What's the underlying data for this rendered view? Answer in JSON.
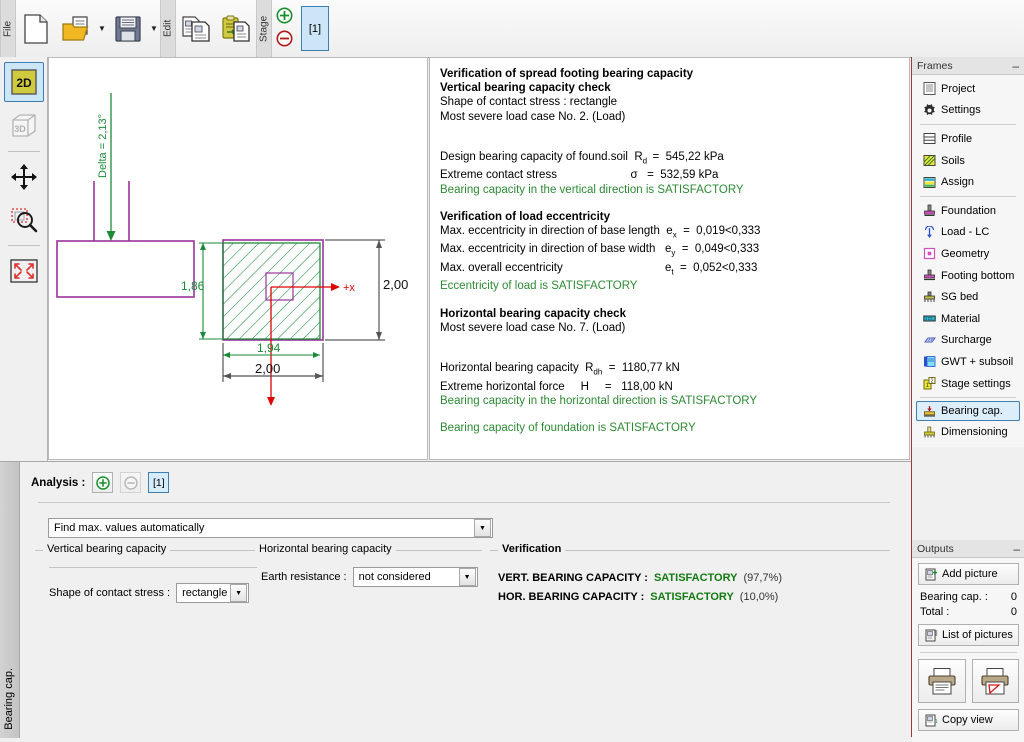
{
  "toolbar": {
    "groups": [
      {
        "caption": "File",
        "buttons": [
          {
            "name": "new-file-button",
            "icon": "new-document-icon"
          },
          {
            "name": "open-file-button",
            "icon": "open-folder-icon",
            "dropdown": true
          },
          {
            "name": "save-file-button",
            "icon": "floppy-save-icon",
            "dropdown": true
          }
        ]
      },
      {
        "caption": "Edit",
        "buttons": [
          {
            "name": "copy-button",
            "icon": "copy-pages-icon"
          },
          {
            "name": "paste-button",
            "icon": "clipboard-paste-icon"
          }
        ]
      },
      {
        "caption": "Stage",
        "buttons": [
          {
            "name": "add-stage-button",
            "icon": "plus-circle-icon"
          },
          {
            "name": "remove-stage-button",
            "icon": "minus-circle-icon"
          }
        ],
        "stage_tab": "[1]"
      }
    ]
  },
  "left_tools": [
    {
      "name": "view-2d-button",
      "label": "2D",
      "selected": true
    },
    {
      "name": "view-3d-button",
      "label": "3D",
      "selected": false
    },
    {
      "name": "pan-tool-button",
      "icon": "move-arrows-icon",
      "selected": false
    },
    {
      "name": "zoom-window-button",
      "icon": "zoom-window-icon",
      "selected": false
    },
    {
      "name": "zoom-all-button",
      "icon": "zoom-extents-icon",
      "selected": false
    },
    {
      "name": "drawing-settings-button",
      "icon": "gear-icon",
      "selected": false
    }
  ],
  "drawing": {
    "delta_label": "Delta = 2,13°",
    "dim_width_inner": "1,86",
    "dim_width_outer": "2,00",
    "dim_length_inner": "1,94",
    "dim_length_outer": "2,00",
    "axis_label": "+x"
  },
  "report": {
    "lines": [
      {
        "text": "Verification of spread footing bearing capacity",
        "style": "bold"
      },
      {
        "text": "Vertical bearing capacity check",
        "style": "bold"
      },
      {
        "text": "Shape of contact stress : rectangle",
        "style": "plain"
      },
      {
        "text": "Most severe load case No. 2. (Load)",
        "style": "plain"
      },
      {
        "text": "",
        "style": "gap"
      },
      {
        "text": "",
        "style": "gap"
      },
      {
        "text": "Design bearing capacity of found.soil  R_d  =  545,22 kPa",
        "style": "plain"
      },
      {
        "text": "Extreme contact stress                       σ   =  532,59 kPa",
        "style": "plain"
      },
      {
        "text": "Bearing capacity in the vertical direction is SATISFACTORY",
        "style": "ok"
      },
      {
        "text": "",
        "style": "gap"
      },
      {
        "text": "Verification of load eccentricity",
        "style": "bold"
      },
      {
        "text": "Max. eccentricity in direction of base length  e_x  =  0,019<0,333",
        "style": "plain"
      },
      {
        "text": "Max. eccentricity in direction of base width   e_y  =  0,049<0,333",
        "style": "plain"
      },
      {
        "text": "Max. overall eccentricity                                 e_t  =  0,052<0,333",
        "style": "plain"
      },
      {
        "text": "Eccentricity of load is SATISFACTORY",
        "style": "ok"
      },
      {
        "text": "",
        "style": "gap"
      },
      {
        "text": "Horizontal bearing capacity check",
        "style": "bold"
      },
      {
        "text": "Most severe load case No. 7. (Load)",
        "style": "plain"
      },
      {
        "text": "",
        "style": "gap"
      },
      {
        "text": "",
        "style": "gap"
      },
      {
        "text": "Horizontal bearing capacity  R_dh  =  1180,77 kN",
        "style": "plain"
      },
      {
        "text": "Extreme horizontal force     H     =   118,00 kN",
        "style": "plain"
      },
      {
        "text": "Bearing capacity in the horizontal direction is SATISFACTORY",
        "style": "ok"
      },
      {
        "text": "",
        "style": "gap"
      },
      {
        "text": "Bearing capacity of foundation is SATISFACTORY",
        "style": "ok"
      }
    ]
  },
  "sidebar": {
    "frames_title": "Frames",
    "minimize_glyph": "–",
    "frames": [
      {
        "label": "Project",
        "icon": "project-document-icon",
        "selected": false
      },
      {
        "label": "Settings",
        "icon": "gear-icon",
        "selected": false
      },
      {
        "sep": true
      },
      {
        "label": "Profile",
        "icon": "profile-layers-icon",
        "selected": false
      },
      {
        "label": "Soils",
        "icon": "soils-hatch-icon",
        "selected": false
      },
      {
        "label": "Assign",
        "icon": "assign-icon",
        "selected": false
      },
      {
        "sep": true
      },
      {
        "label": "Foundation",
        "icon": "foundation-icon",
        "selected": false
      },
      {
        "label": "Load - LC",
        "icon": "load-arrow-icon",
        "selected": false
      },
      {
        "label": "Geometry",
        "icon": "geometry-square-icon",
        "selected": false
      },
      {
        "label": "Footing bottom",
        "icon": "footing-bottom-icon",
        "selected": false
      },
      {
        "label": "SG bed",
        "icon": "sg-bed-icon",
        "selected": false
      },
      {
        "label": "Material",
        "icon": "material-bar-icon",
        "selected": false
      },
      {
        "label": "Surcharge",
        "icon": "surcharge-icon",
        "selected": false
      },
      {
        "label": "GWT + subsoil",
        "icon": "gwt-subsoil-icon",
        "selected": false
      },
      {
        "label": "Stage settings",
        "icon": "stage-settings-icon",
        "selected": false
      },
      {
        "sep": true
      },
      {
        "label": "Bearing cap.",
        "icon": "bearing-capacity-icon",
        "selected": true
      },
      {
        "label": "Dimensioning",
        "icon": "dimensioning-icon",
        "selected": false
      }
    ],
    "outputs": {
      "title": "Outputs",
      "minimize_glyph": "–",
      "add_picture": "Add picture",
      "rows": [
        {
          "label": "Bearing cap. :",
          "value": "0"
        },
        {
          "label": "Total :",
          "value": "0"
        }
      ],
      "list_of_pictures": "List of pictures",
      "print_button": "print-document-button",
      "print_preview_button": "print-preview-button",
      "copy_view": "Copy view"
    }
  },
  "bottom": {
    "side_tab": "Bearing cap.",
    "analysis_label": "Analysis :",
    "add_analysis": "+",
    "remove_analysis": "–",
    "analysis_tab": "[1]",
    "mode_combo": {
      "value": "Find max. values automatically",
      "arrow": "▼"
    },
    "vertical_group": {
      "title": "Vertical bearing capacity",
      "shape_label": "Shape of contact stress :",
      "shape_value": "rectangle",
      "arrow": "▼"
    },
    "horizontal_group": {
      "title": "Horizontal bearing capacity",
      "earth_label": "Earth resistance :",
      "earth_value": "not considered",
      "arrow": "▼"
    },
    "verification_group": {
      "title": "Verification",
      "rows": [
        {
          "name": "VERT. BEARING CAPACITY :",
          "status": "SATISFACTORY",
          "percent": "(97,7%)"
        },
        {
          "name": "HOR. BEARING CAPACITY :",
          "status": "SATISFACTORY",
          "percent": "(10,0%)"
        }
      ]
    }
  },
  "colors": {
    "ok_green": "#2d8a34",
    "status_green": "#137a13",
    "selection_blue": "#3c7fb1",
    "magenta": "#993399",
    "draw_green": "#1d8a3a",
    "draw_red": "#e00000",
    "sidebar_border": "#9c3a3a"
  }
}
